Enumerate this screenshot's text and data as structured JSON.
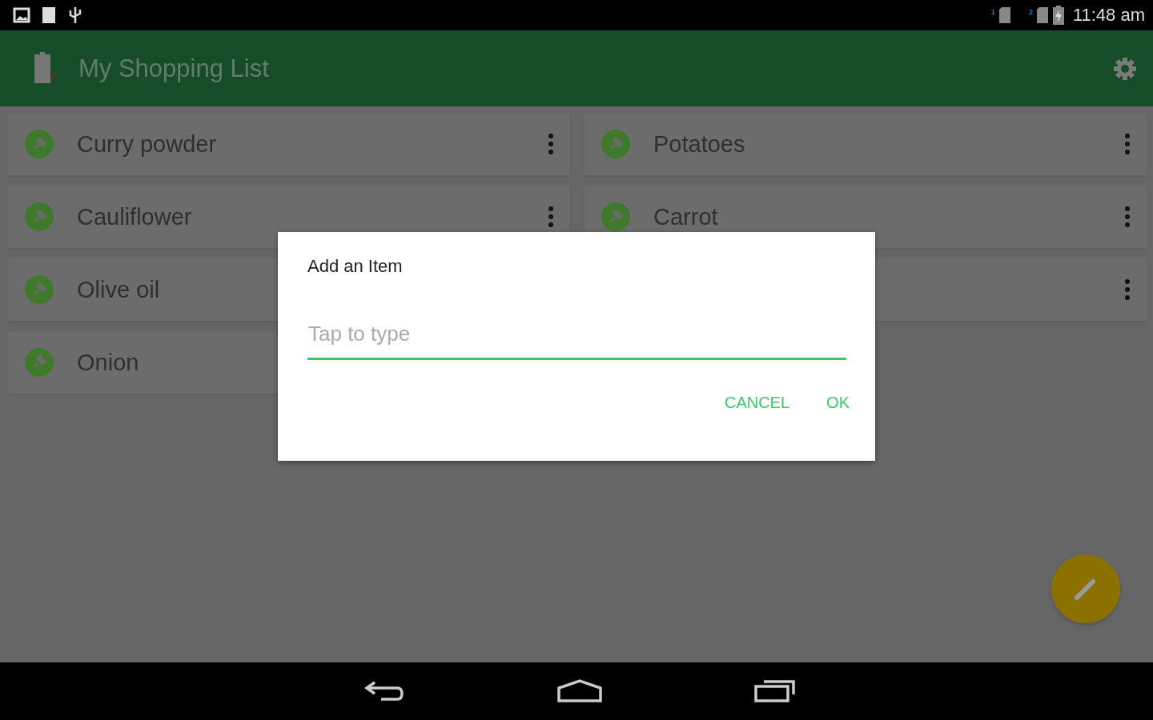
{
  "status_bar": {
    "time": "11:48 am",
    "sims": [
      {
        "label": "1"
      },
      {
        "label": "2"
      }
    ]
  },
  "app_bar": {
    "title": "My Shopping List"
  },
  "columns": [
    [
      {
        "name": "Curry powder"
      },
      {
        "name": "Cauliflower"
      },
      {
        "name": "Olive oil"
      },
      {
        "name": "Onion"
      }
    ],
    [
      {
        "name": "Potatoes"
      },
      {
        "name": "Carrot"
      },
      {}
    ]
  ],
  "dialog": {
    "title": "Add an Item",
    "field": {
      "placeholder": "Tap to type"
    },
    "buttons": [
      "CANCEL",
      "OK"
    ]
  }
}
